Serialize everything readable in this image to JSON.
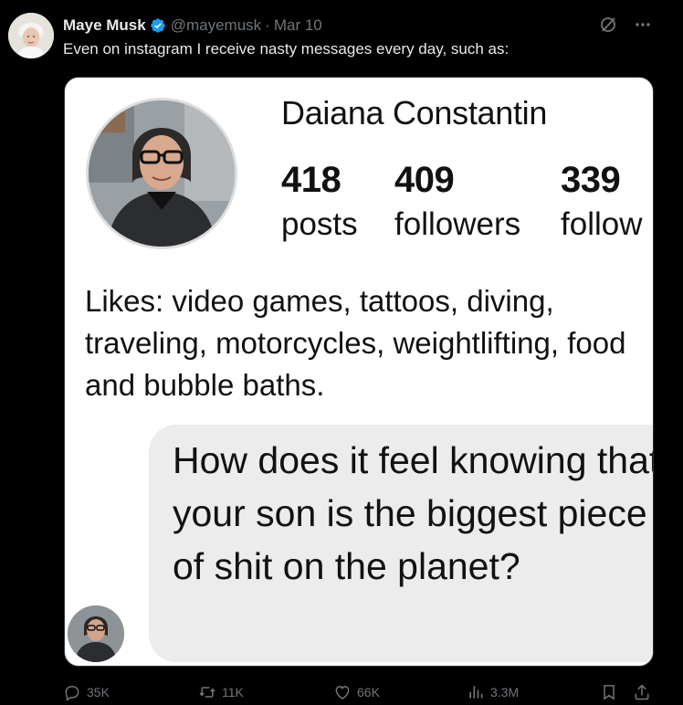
{
  "author": {
    "name": "Maye Musk",
    "handle": "@mayemusk",
    "separator": "·",
    "date": "Mar 10"
  },
  "tweet": {
    "text": "Even on instagram I receive nasty messages every day, such as:"
  },
  "media": {
    "profile_name": "Daiana Constantin",
    "stats": [
      {
        "num": "418",
        "label": "posts"
      },
      {
        "num": "409",
        "label": "followers"
      },
      {
        "num": "339",
        "label": "follow"
      }
    ],
    "likes_text": "Likes: video games, tattoos, diving, traveling, motorcycles, weightlifting, food and bubble baths.",
    "message": "How does it feel knowing that your son is the biggest piece of shit on the planet?"
  },
  "actions": {
    "replies": "35K",
    "reposts": "11K",
    "likes": "66K",
    "views": "3.3M"
  },
  "colors": {
    "background": "#000000",
    "text_primary": "#e7e9ea",
    "text_secondary": "#71767b",
    "verified_blue": "#1d9bf0",
    "bubble_gray": "#ececec"
  },
  "icons": [
    "verified-badge-icon",
    "grok-icon",
    "more-icon",
    "reply-icon",
    "repost-icon",
    "like-icon",
    "views-icon",
    "bookmark-icon",
    "share-icon"
  ]
}
